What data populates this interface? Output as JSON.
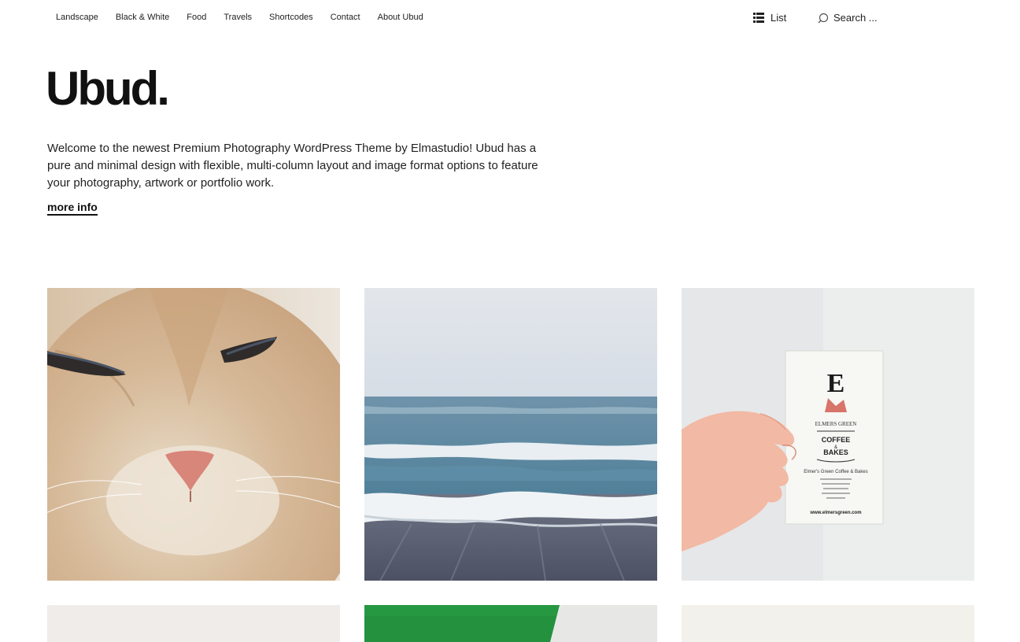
{
  "nav": {
    "items": [
      "Landscape",
      "Black & White",
      "Food",
      "Travels",
      "Shortcodes",
      "Contact",
      "About Ubud"
    ]
  },
  "view_toggle": {
    "label": "List",
    "icon": "list-icon"
  },
  "search": {
    "placeholder": "Search ...",
    "icon": "search-icon"
  },
  "site": {
    "title": "Ubud.",
    "intro": "Welcome to the newest Premium Photography WordPress Theme by Elmastudio! Ubud has a pure and minimal design with flexible, multi-column layout and image format options to feature your photography, artwork or portfolio work.",
    "more_info": "more info"
  },
  "gallery": {
    "items": [
      {
        "subject": "cat close-up"
      },
      {
        "subject": "ocean waves on beach"
      },
      {
        "subject": "hand holding business card"
      },
      {
        "subject": "light photo"
      },
      {
        "subject": "green photo"
      },
      {
        "subject": "light photo"
      }
    ],
    "card": {
      "letter": "E",
      "brand": "ELMERS GREEN",
      "headline_top": "COFFEE",
      "headline_mid": "&",
      "headline_bottom": "BAKES",
      "subtitle": "Elmer's Green Coffee & Bakes",
      "url": "www.elmersgreen.com"
    }
  },
  "colors": {
    "text": "#111111",
    "background": "#ffffff"
  }
}
